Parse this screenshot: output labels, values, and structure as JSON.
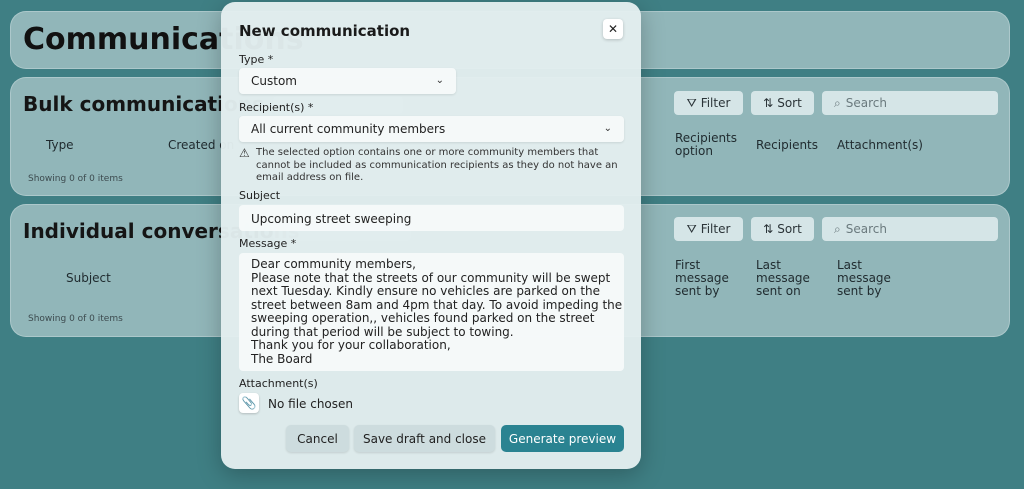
{
  "page": {
    "title": "Communications"
  },
  "bulk": {
    "title": "Bulk communications",
    "filter_label": "Filter",
    "sort_label": "Sort",
    "search_placeholder": "Search",
    "columns": [
      "Type",
      "Created on",
      "Recipients option",
      "Recipients",
      "Attachment(s)"
    ],
    "showing": "Showing 0 of 0 items"
  },
  "individual": {
    "title": "Individual conversations",
    "filter_label": "Filter",
    "sort_label": "Sort",
    "search_placeholder": "Search",
    "columns": [
      "Subject",
      "First message sent by",
      "Last message sent on",
      "Last message sent by"
    ],
    "showing": "Showing 0 of 0 items"
  },
  "modal": {
    "title": "New communication",
    "close_glyph": "✕",
    "type_label": "Type *",
    "type_value": "Custom",
    "recipients_label": "Recipient(s) *",
    "recipients_value": "All current community members",
    "warning": "The selected option contains one or more community members that cannot be included as communication recipients as they do not have an email address on file.",
    "subject_label": "Subject",
    "subject_value": "Upcoming street sweeping",
    "message_label": "Message *",
    "message_lines": [
      "Dear community members,",
      "Please note that the streets of our community will be swept",
      "next Tuesday. Kindly ensure no vehicles are parked on the",
      "street between 8am and 4pm that day. To avoid impeding the",
      "sweeping operation,, vehicles found parked on the street",
      "during that period will be subject to towing.",
      "Thank you for your collaboration,",
      "The Board"
    ],
    "attachments_label": "Attachment(s)",
    "file_status": "No file chosen",
    "cancel_label": "Cancel",
    "save_label": "Save draft and close",
    "preview_label": "Generate preview"
  },
  "colors": {
    "background": "#3f7f84",
    "primary_button": "#2a8391"
  }
}
